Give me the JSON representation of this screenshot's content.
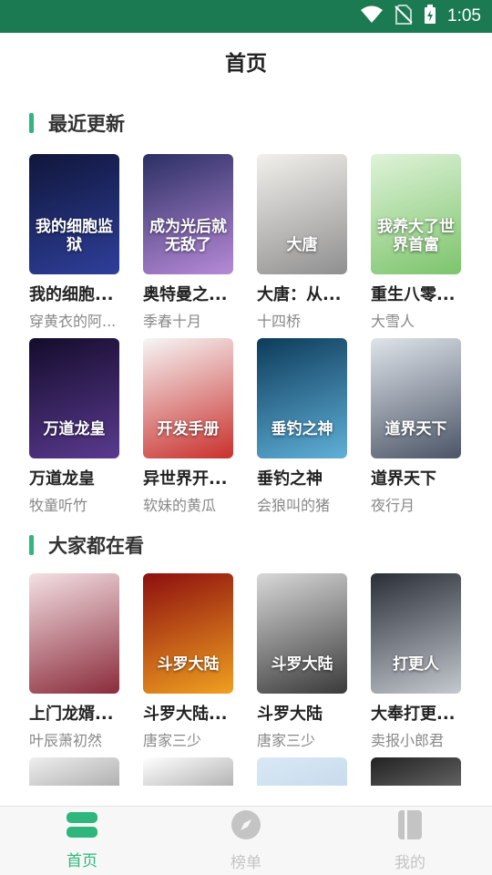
{
  "status_bar": {
    "time": "1:05"
  },
  "header": {
    "title": "首页"
  },
  "sections": [
    {
      "title": "最近更新"
    },
    {
      "title": "大家都在看"
    }
  ],
  "recent": [
    {
      "title": "我的细胞...",
      "author": "穿黄衣的阿...",
      "cover_text": "我的细胞监狱",
      "colors": [
        "#10163a",
        "#2e3f9a"
      ]
    },
    {
      "title": "奥特曼之...",
      "author": "季春十月",
      "cover_text": "成为光后就无敌了",
      "colors": [
        "#2b2f63",
        "#b78ad8"
      ]
    },
    {
      "title": "大唐：从...",
      "author": "十四桥",
      "cover_text": "大唐",
      "colors": [
        "#f2f0ec",
        "#8f8f8f"
      ]
    },
    {
      "title": "重生八零...",
      "author": "大雪人",
      "cover_text": "我养大了世界首富",
      "colors": [
        "#dff3d9",
        "#7cc46b"
      ]
    },
    {
      "title": "万道龙皇",
      "author": "牧童听竹",
      "cover_text": "万道龙皇",
      "colors": [
        "#140c2c",
        "#5a3a8f"
      ]
    },
    {
      "title": "异世界开...",
      "author": "软妹的黄瓜",
      "cover_text": "开发手册",
      "colors": [
        "#f6f6f6",
        "#c9302c"
      ]
    },
    {
      "title": "垂钓之神",
      "author": "会狼叫的猪",
      "cover_text": "垂钓之神",
      "colors": [
        "#0d3b5a",
        "#5fb0d8"
      ]
    },
    {
      "title": "道界天下",
      "author": "夜行月",
      "cover_text": "道界天下",
      "colors": [
        "#dfe4ea",
        "#4b5566"
      ]
    }
  ],
  "popular": [
    {
      "title": "上门龙婿...",
      "author": "叶辰萧初然",
      "cover_text": "",
      "colors": [
        "#f4e0e4",
        "#8a2b3a"
      ]
    },
    {
      "title": "斗罗大陆...",
      "author": "唐家三少",
      "cover_text": "斗罗大陆",
      "colors": [
        "#8d0f0f",
        "#f0a020"
      ]
    },
    {
      "title": "斗罗大陆",
      "author": "唐家三少",
      "cover_text": "斗罗大陆",
      "colors": [
        "#d8d8d8",
        "#3a3a3a"
      ]
    },
    {
      "title": "大奉打更...",
      "author": "卖报小郎君",
      "cover_text": "打更人",
      "colors": [
        "#2a2e36",
        "#c4c8cf"
      ]
    },
    {
      "title": "",
      "author": "",
      "cover_text": "",
      "colors": [
        "#eeeeee",
        "#555555"
      ]
    },
    {
      "title": "",
      "author": "",
      "cover_text": "",
      "colors": [
        "#ffffff",
        "#444444"
      ]
    },
    {
      "title": "",
      "author": "",
      "cover_text": "",
      "colors": [
        "#d9e8f5",
        "#b0c8e0"
      ]
    },
    {
      "title": "",
      "author": "",
      "cover_text": "",
      "colors": [
        "#222222",
        "#c0c0c0"
      ]
    }
  ],
  "nav": [
    {
      "label": "首页",
      "active": true
    },
    {
      "label": "榜单",
      "active": false
    },
    {
      "label": "我的",
      "active": false
    }
  ],
  "colors": {
    "accent": "#2fb67c",
    "status_bar": "#1b7a52",
    "inactive": "#c4c4c4"
  }
}
